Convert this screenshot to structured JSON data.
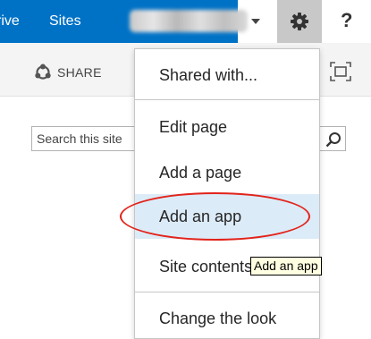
{
  "suite_bar": {
    "links": [
      {
        "label": "rive"
      },
      {
        "label": "Sites"
      }
    ],
    "user_name_obscured": "",
    "colors": {
      "brand": "#0072c6",
      "gear_bg": "#c8c8c8"
    },
    "icons": [
      "gear-icon",
      "help-icon",
      "chevron-down-icon"
    ],
    "help_label": "?"
  },
  "ribbon": {
    "share_label": "SHARE",
    "icons": [
      "share-icon",
      "focus-on-content-icon"
    ]
  },
  "search": {
    "placeholder": "Search this site"
  },
  "settings_menu": {
    "items": [
      {
        "label": "Shared with..."
      },
      {
        "label": "Edit page"
      },
      {
        "label": "Add a page"
      },
      {
        "label": "Add an app",
        "highlighted": true
      },
      {
        "label": "Site contents"
      },
      {
        "label": "Change the look"
      }
    ],
    "colors": {
      "highlight": "#dcebf8",
      "annotation": "#e2231a"
    }
  },
  "tooltip": {
    "text": "Add an app"
  }
}
